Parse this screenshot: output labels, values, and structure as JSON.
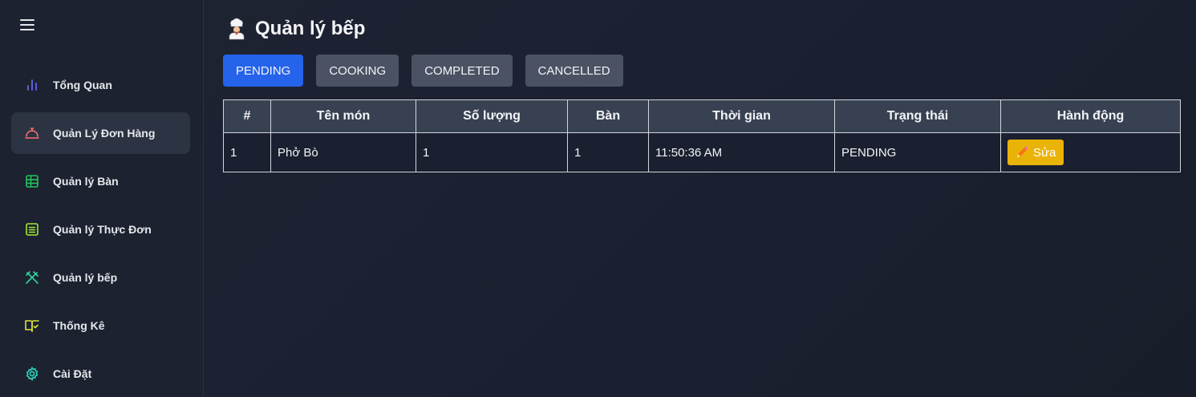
{
  "sidebar": {
    "items": [
      {
        "label": "Tổng Quan",
        "icon": "bar-chart-icon",
        "color": "#6366f1",
        "active": false
      },
      {
        "label": "Quản Lý Đơn Hàng",
        "icon": "cloche-icon",
        "color": "#f87171",
        "active": true
      },
      {
        "label": "Quản lý Bàn",
        "icon": "table-grid-icon",
        "color": "#22c55e",
        "active": false
      },
      {
        "label": "Quản lý Thực Đơn",
        "icon": "menu-list-icon",
        "color": "#a3e635",
        "active": false
      },
      {
        "label": "Quản lý bếp",
        "icon": "utensils-crossed-icon",
        "color": "#34d399",
        "active": false
      },
      {
        "label": "Thống Kê",
        "icon": "book-check-icon",
        "color": "#d9e63a",
        "active": false
      },
      {
        "label": "Cài Đặt",
        "icon": "gear-icon",
        "color": "#2dd4bf",
        "active": false
      }
    ]
  },
  "main": {
    "title": "Quản lý bếp",
    "tabs": [
      "PENDING",
      "COOKING",
      "COMPLETED",
      "CANCELLED"
    ],
    "active_tab": "PENDING",
    "table": {
      "headers": [
        "#",
        "Tên món",
        "Số lượng",
        "Bàn",
        "Thời gian",
        "Trạng thái",
        "Hành động"
      ],
      "rows": [
        {
          "index": "1",
          "dish": "Phở Bò",
          "quantity": "1",
          "table": "1",
          "time": "11:50:36 AM",
          "status": "PENDING",
          "action": "Sửa"
        }
      ]
    }
  },
  "colors": {
    "accent": "#2563eb",
    "edit_button": "#eab308"
  }
}
